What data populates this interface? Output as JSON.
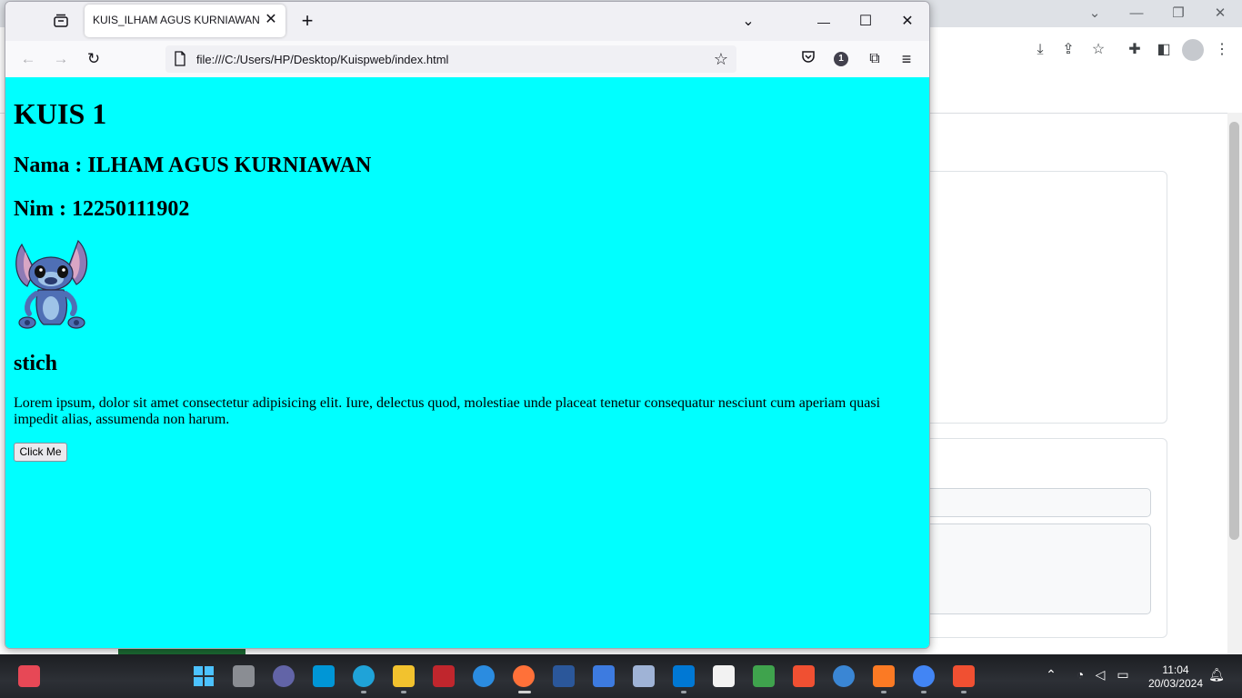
{
  "background_browser": {
    "window_controls": [
      "⌄",
      "—",
      "❐",
      "✕"
    ]
  },
  "firefox": {
    "tab_title": "KUIS_ILHAM AGUS KURNIAWAN",
    "url": "file:///C:/Users/HP/Desktop/Kuispweb/index.html",
    "extension_badge": "1",
    "window_controls": [
      "⌄",
      "—",
      "☐",
      "✕"
    ]
  },
  "page": {
    "background_color": "#00ffff",
    "heading": "KUIS 1",
    "name_line": "Nama : ILHAM AGUS KURNIAWAN",
    "nim_line": "Nim : 12250111902",
    "image_icon": "stitch-illustration",
    "caption": "stich",
    "paragraph": "Lorem ipsum, dolor sit amet consectetur adipisicing elit. Iure, delectus quod, molestiae unde placeat tenetur consequatur nesciunt cum aperiam quasi impedit alias, assumenda non harum.",
    "button_label": "Click Me"
  },
  "taskbar": {
    "time": "11:04",
    "date": "20/03/2024",
    "apps": [
      "widgets-icon",
      "start-icon",
      "task-view-icon",
      "teams-chat-icon",
      "myhp-icon",
      "edge-icon",
      "file-explorer-icon",
      "mcafee-icon",
      "help-icon",
      "firefox-icon",
      "word-icon",
      "news-icon",
      "virtualbox-icon",
      "vscode-icon",
      "notion-icon",
      "snipping-icon",
      "git-icon",
      "font-icon",
      "xampp-icon",
      "chrome-icon",
      "git-gui-icon"
    ]
  }
}
